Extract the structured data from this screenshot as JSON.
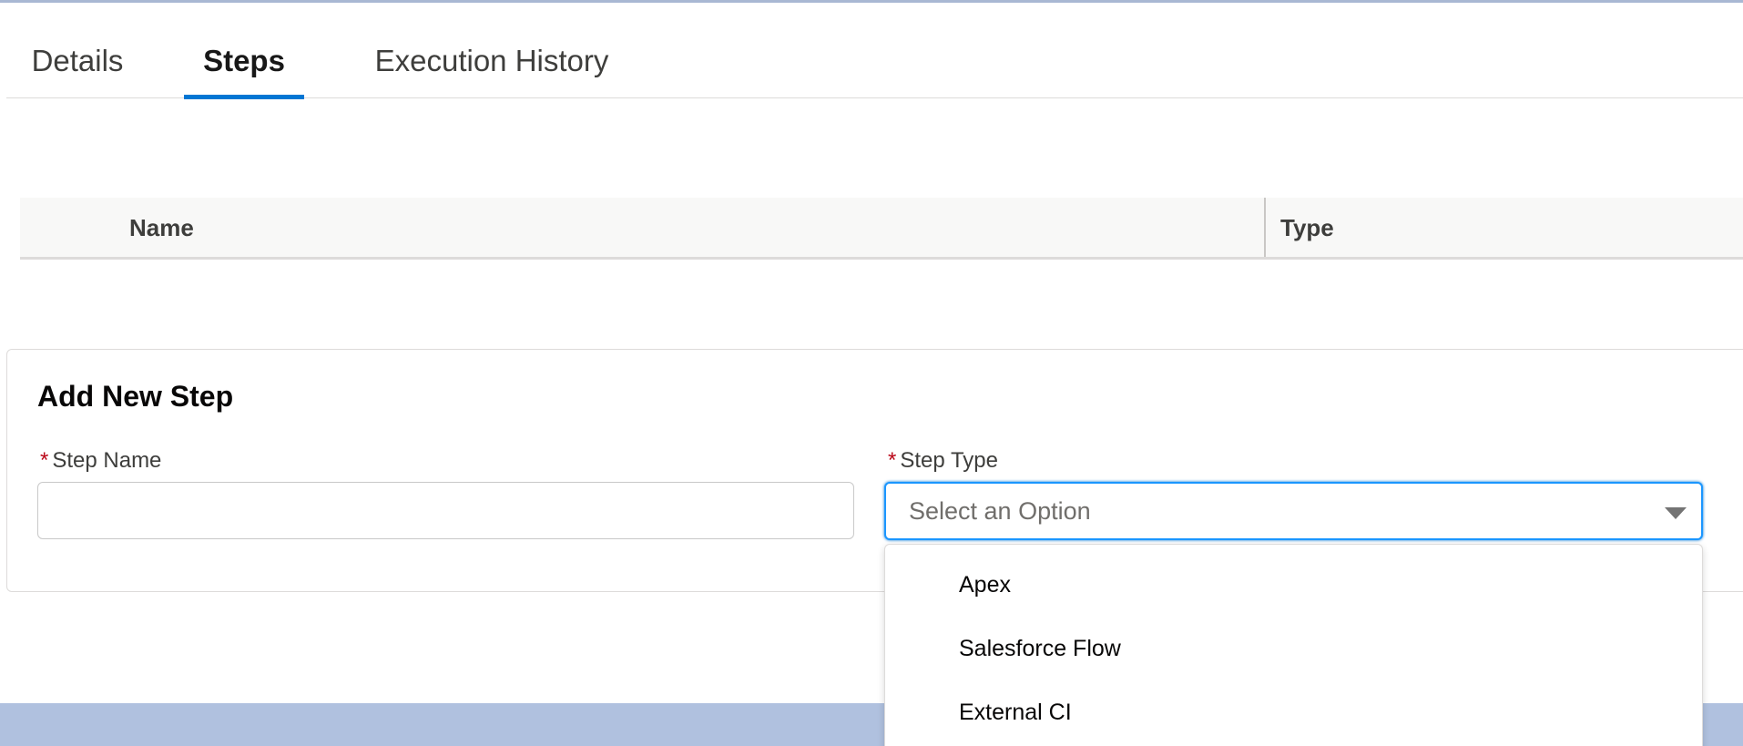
{
  "tabs": [
    {
      "label": "Details",
      "active": false
    },
    {
      "label": "Steps",
      "active": true
    },
    {
      "label": "Execution History",
      "active": false
    }
  ],
  "table": {
    "columns": [
      "Name",
      "Type"
    ]
  },
  "add_step": {
    "title": "Add New Step",
    "required_marker": "*",
    "step_name_label": "Step Name",
    "step_name_value": "",
    "step_type_label": "Step Type",
    "step_type_placeholder": "Select an Option",
    "options": [
      "Apex",
      "Salesforce Flow",
      "External CI"
    ]
  },
  "colors": {
    "accent": "#0176d3",
    "focus_border": "#1b96ff",
    "required": "#ba0517",
    "footer": "#b0c1df"
  },
  "icons": {
    "combo_caret": "chevron-down-icon"
  }
}
